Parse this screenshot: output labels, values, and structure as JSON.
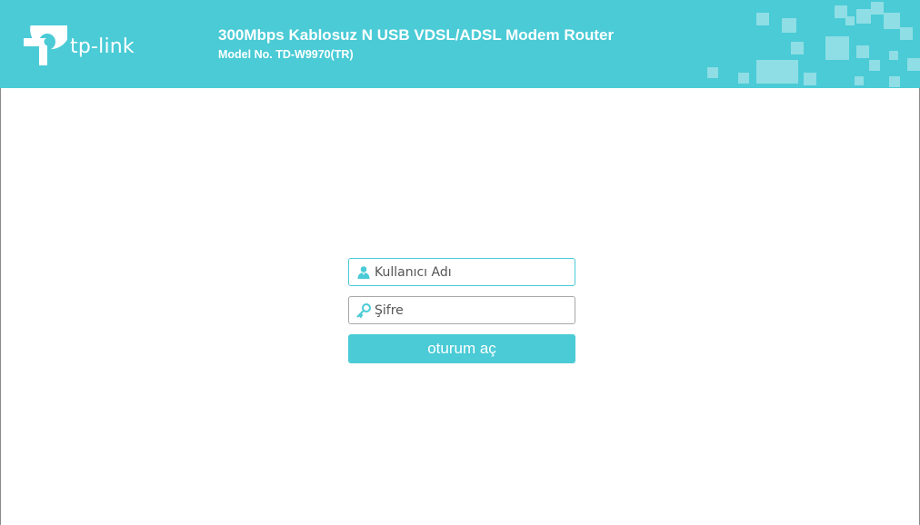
{
  "brand": {
    "logo_text": "tp-link",
    "accent_color": "#4acbd6",
    "logo_icon": "tp-link-logo-icon"
  },
  "header": {
    "product_name": "300Mbps Kablosuz N USB VDSL/ADSL Modem Router",
    "model_line": "Model No. TD-W9970(TR)"
  },
  "login": {
    "username": {
      "placeholder": "Kullanıcı Adı",
      "value": "",
      "icon": "user-icon"
    },
    "password": {
      "placeholder": "Şifre",
      "value": "",
      "icon": "key-icon"
    },
    "submit_label": "oturum aç"
  }
}
